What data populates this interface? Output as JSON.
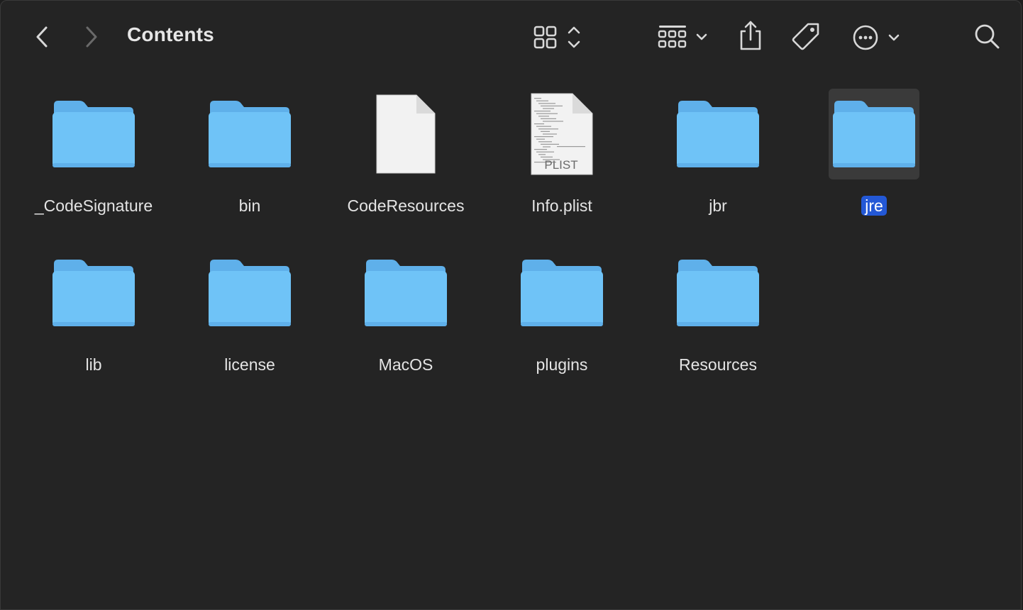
{
  "window": {
    "title": "Contents"
  },
  "toolbar": {
    "icons": [
      "chevron-left-icon",
      "chevron-right-icon",
      "icon-view-icon",
      "group-by-icon",
      "share-icon",
      "tag-icon",
      "more-icon",
      "search-icon"
    ]
  },
  "colors": {
    "background": "#242424",
    "folder_body": "#6fc3f7",
    "folder_tab": "#5fb0ea",
    "selection_label": "#2358d6",
    "selection_bg": "#3a3a3a"
  },
  "items": [
    {
      "name": "_CodeSignature",
      "kind": "folder"
    },
    {
      "name": "bin",
      "kind": "folder"
    },
    {
      "name": "CodeResources",
      "kind": "document"
    },
    {
      "name": "Info.plist",
      "kind": "plist",
      "badge": "PLIST"
    },
    {
      "name": "jbr",
      "kind": "folder"
    },
    {
      "name": "jre",
      "kind": "folder",
      "selected": true
    },
    {
      "name": "lib",
      "kind": "folder"
    },
    {
      "name": "license",
      "kind": "folder"
    },
    {
      "name": "MacOS",
      "kind": "folder"
    },
    {
      "name": "plugins",
      "kind": "folder"
    },
    {
      "name": "Resources",
      "kind": "folder"
    }
  ]
}
